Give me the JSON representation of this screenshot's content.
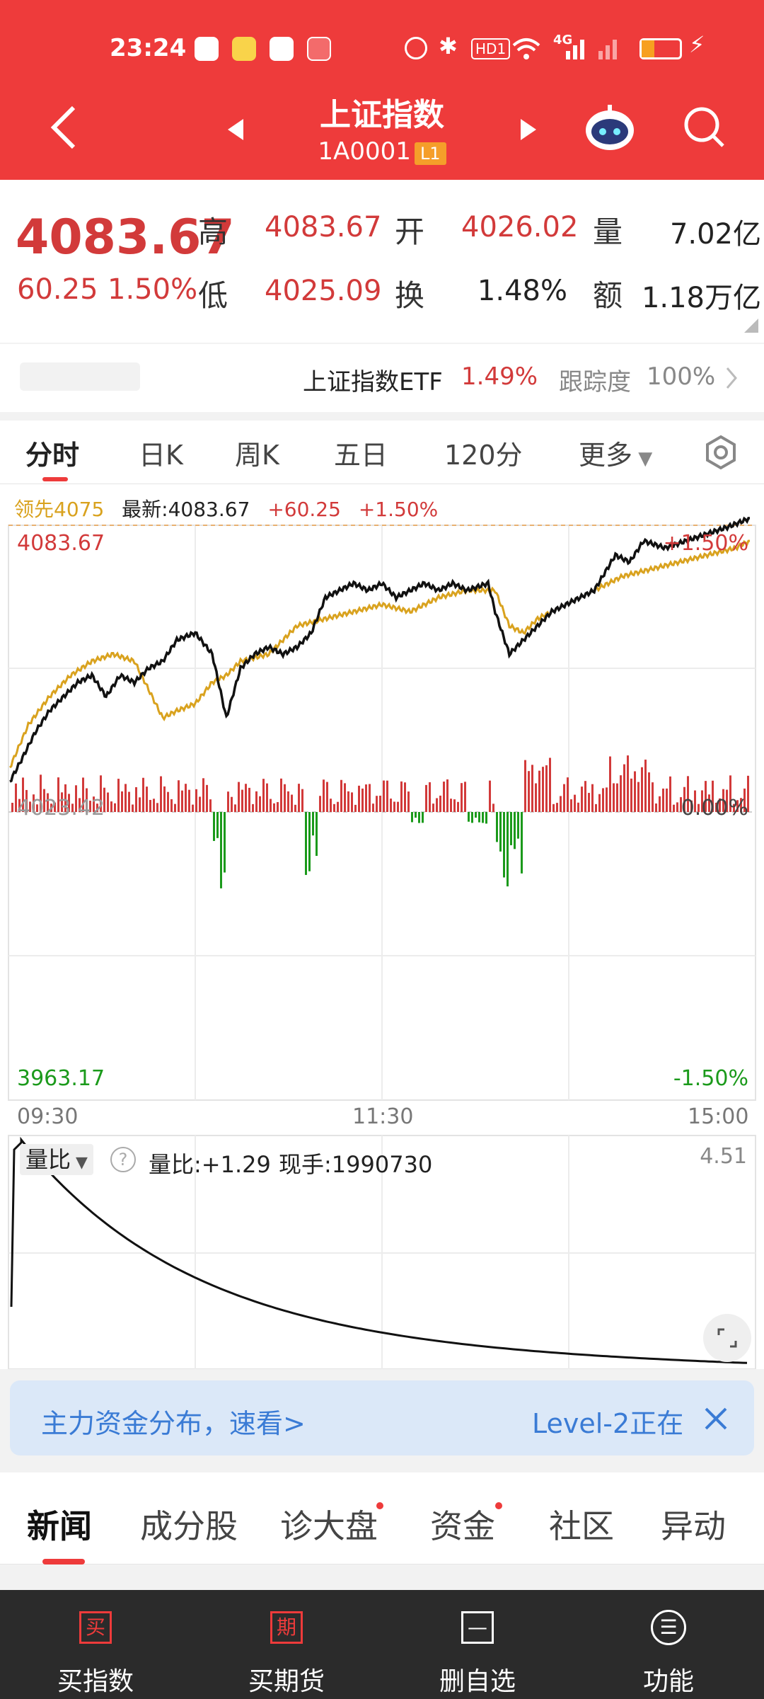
{
  "status_bar": {
    "time": "23:24",
    "network": "4G",
    "hd": "HD1"
  },
  "header": {
    "title": "上证指数",
    "code": "1A0001",
    "level": "L1"
  },
  "quote": {
    "price": "4083.67",
    "change": "60.25",
    "change_pct": "1.50%",
    "high_label": "高",
    "high": "4083.67",
    "open_label": "开",
    "open": "4026.02",
    "volume_label": "量",
    "volume": "7.02亿",
    "low_label": "低",
    "low": "4025.09",
    "turnover_label": "换",
    "turnover": "1.48%",
    "amount_label": "额",
    "amount": "1.18万亿"
  },
  "etf": {
    "name": "上证指数ETF",
    "pct": "1.49%",
    "tracking_label": "跟踪度",
    "tracking": "100%"
  },
  "period_tabs": [
    "分时",
    "日K",
    "周K",
    "五日",
    "120分",
    "更多"
  ],
  "chart": {
    "legend_lead": "领先4075",
    "legend_latest": "最新:4083.67",
    "legend_change": "+60.25",
    "legend_pct": "+1.50%",
    "top_price": "4083.67",
    "top_pct": "+1.50%",
    "mid_price": "4023.42",
    "mid_pct": "0.00%",
    "bottom_price": "3963.17",
    "bottom_pct": "-1.50%",
    "time_start": "09:30",
    "time_mid": "11:30",
    "time_end": "15:00"
  },
  "sub_chart": {
    "selector": "量比",
    "ratio": "量比:+1.29",
    "hand": "现手:1990730",
    "max": "4.51"
  },
  "banner": {
    "text": "主力资金分布，速看>",
    "right": "Level-2正在"
  },
  "news_tabs": [
    "新闻",
    "成分股",
    "诊大盘",
    "资金",
    "社区",
    "异动"
  ],
  "bottom_nav": [
    {
      "label": "买指数",
      "icon": "买"
    },
    {
      "label": "买期货",
      "icon": "期"
    },
    {
      "label": "删自选",
      "icon": "—"
    },
    {
      "label": "功能",
      "icon": "☰"
    }
  ],
  "colors": {
    "brand": "#ee3b3b",
    "up": "#d23a3a",
    "down": "#1b9a1b",
    "avg_line": "#d9a21e"
  }
}
